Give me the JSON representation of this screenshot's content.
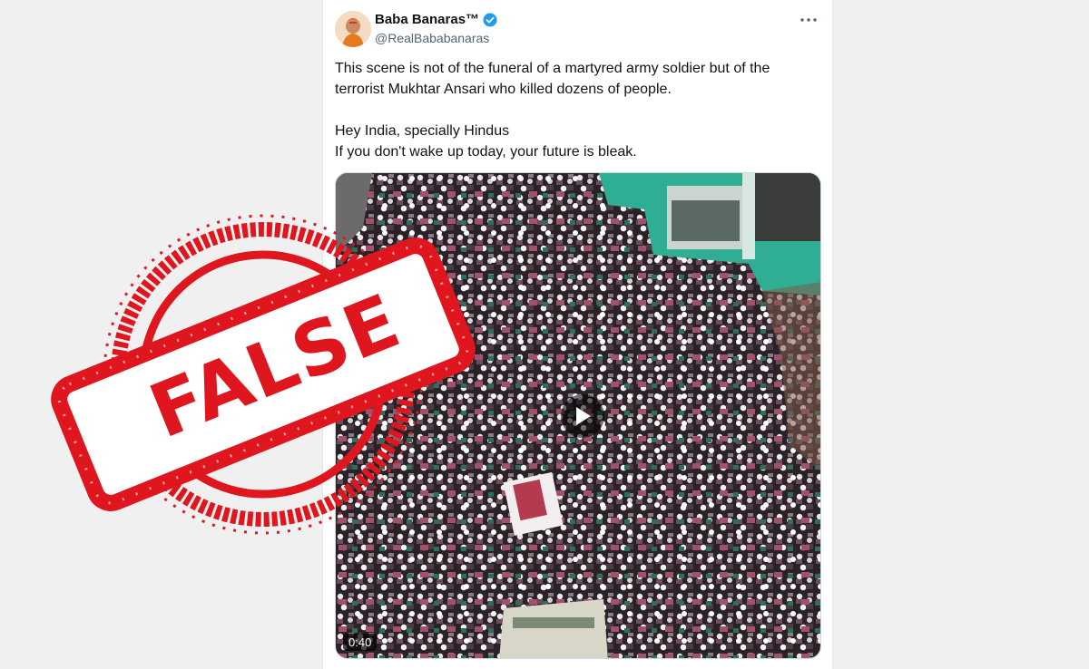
{
  "post": {
    "author_name": "Baba Banaras™",
    "handle": "@RealBababanaras",
    "text": "This scene is not of the funeral of a martyred army soldier but of the terrorist Mukhtar Ansari who killed dozens of people.\n\nHey India, specially Hindus\nIf you don't wake up today, your future is bleak.",
    "video": {
      "duration": "0:40"
    }
  },
  "stamp": {
    "label": "FALSE",
    "color": "#e0161f"
  },
  "colors": {
    "verified": "#1d9bf0",
    "text": "#0f1419",
    "muted": "#536471"
  },
  "icons": {
    "verified": "verified-badge-icon",
    "more": "more-options-icon",
    "play": "play-icon"
  }
}
